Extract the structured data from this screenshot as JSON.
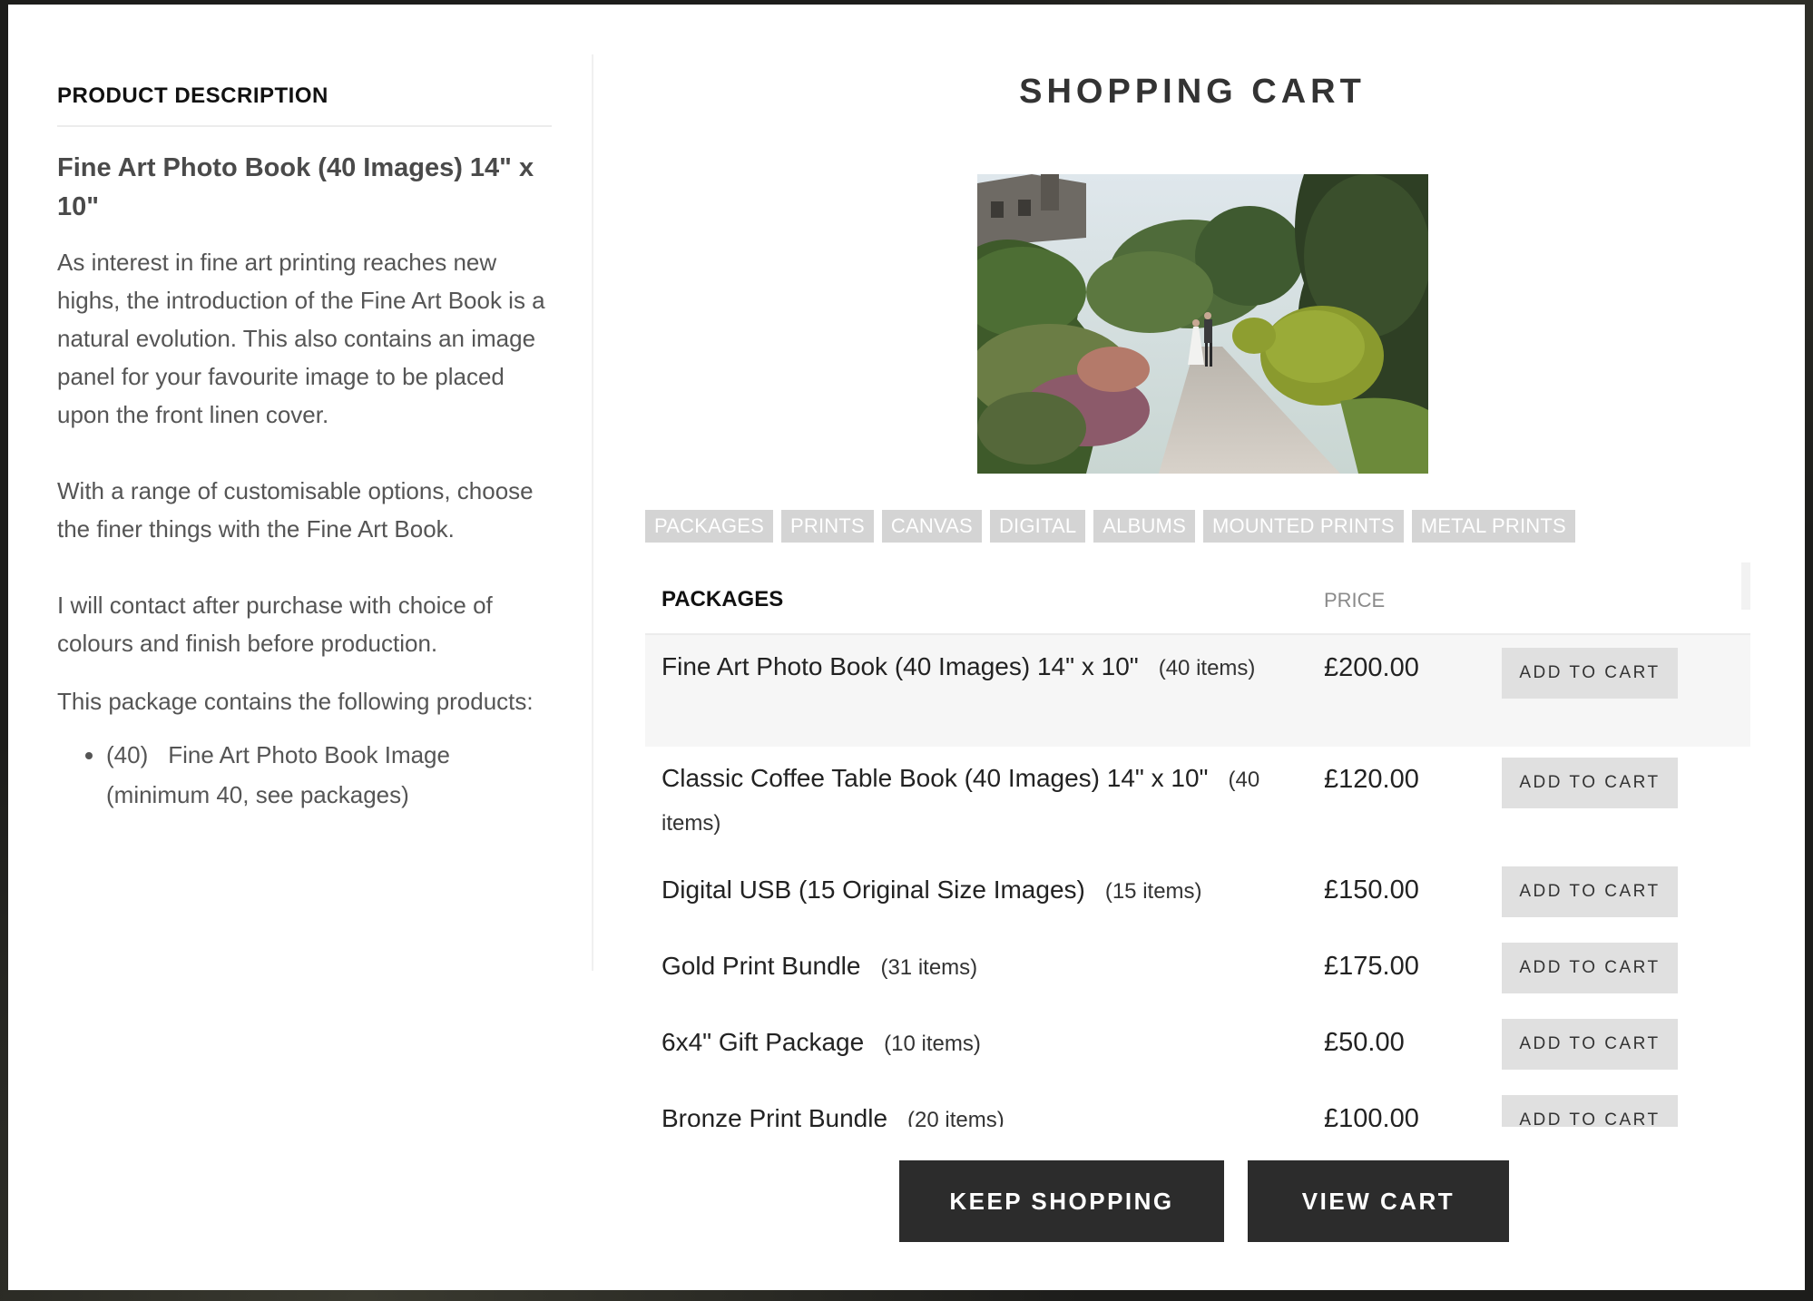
{
  "description": {
    "heading": "PRODUCT DESCRIPTION",
    "product_title": "Fine Art Photo Book (40 Images) 14\" x 10\"",
    "paragraphs": [
      "As interest in fine art printing reaches new highs, the introduction of the Fine Art Book is a natural evolution. This also contains an image panel for your favourite image to be placed upon the front linen cover.",
      "With a range of customisable options, choose the finer things with the Fine Art Book.",
      "I will contact after purchase with choice of colours and finish before production."
    ],
    "contains_label": "This package contains the following products:",
    "products": [
      {
        "qty": "(40)",
        "name": "Fine Art Photo Book Image (minimum 40, see packages)"
      }
    ]
  },
  "cart": {
    "title": "SHOPPING CART",
    "tabs": [
      "PACKAGES",
      "PRINTS",
      "CANVAS",
      "DIGITAL",
      "ALBUMS",
      "MOUNTED PRINTS",
      "METAL PRINTS"
    ],
    "columns": {
      "packages": "PACKAGES",
      "price": "PRICE"
    },
    "rows": [
      {
        "name": "Fine Art Photo Book (40 Images) 14\" x 10\"",
        "items": "(40 items)",
        "price": "£200.00",
        "button": "ADD TO CART"
      },
      {
        "name": "Classic Coffee Table Book (40 Images) 14\" x 10\"",
        "items": "(40 items)",
        "price": "£120.00",
        "button": "ADD TO CART"
      },
      {
        "name": "Digital USB (15 Original Size Images)",
        "items": "(15 items)",
        "price": "£150.00",
        "button": "ADD TO CART"
      },
      {
        "name": "Gold Print Bundle",
        "items": "(31 items)",
        "price": "£175.00",
        "button": "ADD TO CART"
      },
      {
        "name": "6x4\" Gift Package",
        "items": "(10 items)",
        "price": "£50.00",
        "button": "ADD TO CART"
      },
      {
        "name": "Bronze Print Bundle",
        "items": "(20 items)",
        "price": "£100.00",
        "button": "ADD TO CART"
      }
    ],
    "keep_shopping": "KEEP SHOPPING",
    "view_cart": "VIEW CART"
  },
  "colors": {
    "tab_bg": "#d4d4d4",
    "button_dark": "#2c2c2c",
    "button_light": "#e0e0e0",
    "row_highlight": "#f6f6f6"
  }
}
